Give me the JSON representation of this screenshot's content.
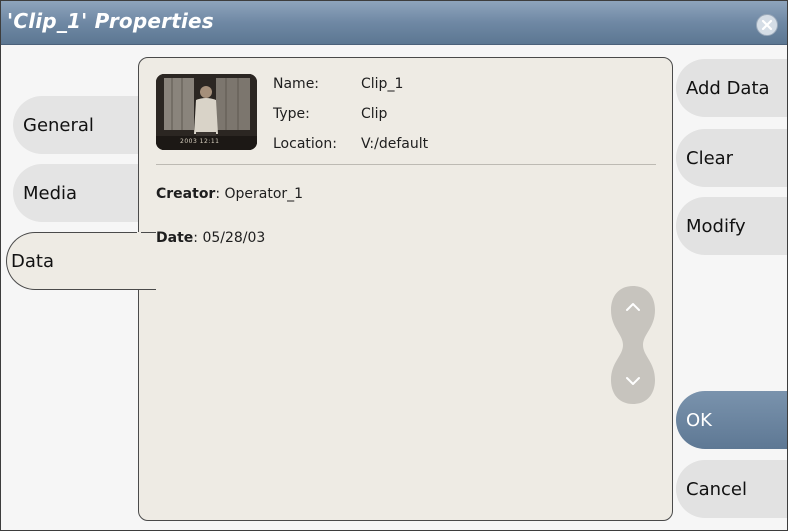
{
  "window": {
    "title": "'Clip_1' Properties",
    "close_icon": "close-icon"
  },
  "tabs": [
    {
      "label": "General"
    },
    {
      "label": "Media"
    },
    {
      "label": "Data",
      "active": true
    }
  ],
  "clip": {
    "thumbnail_caption": "2003 12:11",
    "name_label": "Name:",
    "name_value": "Clip_1",
    "type_label": "Type:",
    "type_value": "Clip",
    "location_label": "Location:",
    "location_value": "V:/default"
  },
  "data_fields": [
    {
      "key": "Creator",
      "sep": ": ",
      "value": "Operator_1"
    },
    {
      "key": "Date",
      "sep": ": ",
      "value": "05/28/03"
    }
  ],
  "scroll": {
    "up_icon": "chevron-up-icon",
    "down_icon": "chevron-down-icon"
  },
  "actions": {
    "add_data": "Add Data",
    "clear": "Clear",
    "modify": "Modify",
    "ok": "OK",
    "cancel": "Cancel"
  },
  "colors": {
    "titlebar": "#6f88a4",
    "panel": "#eeebe4",
    "primary_button": "#6882a0"
  }
}
